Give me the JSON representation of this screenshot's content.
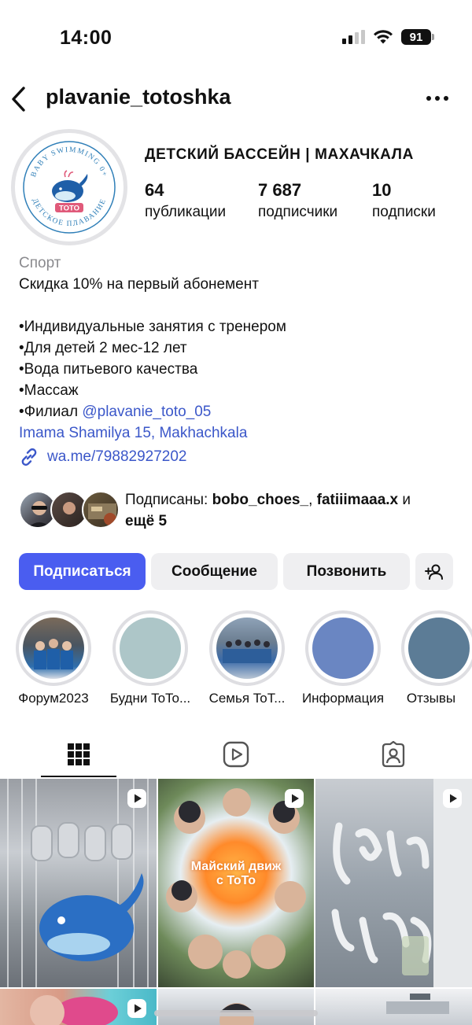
{
  "status_bar": {
    "time": "14:00",
    "battery": "91"
  },
  "header": {
    "username": "plavanie_totoshka"
  },
  "avatar": {
    "ring_text_top": "BABY SWIMMING 0+",
    "ring_text_bottom": "ДЕТСКОЕ ПЛАВАНИЕ",
    "brand": "TOTO"
  },
  "profile": {
    "display_name": "ДЕТСКИЙ БАССЕЙН | МАХАЧКАЛА",
    "stats": [
      {
        "value": "64",
        "label": "публикации"
      },
      {
        "value": "7 687",
        "label": "подписчики"
      },
      {
        "value": "10",
        "label": "подписки"
      }
    ]
  },
  "bio": {
    "category": "Спорт",
    "line1": "Скидка 10% на первый абонемент",
    "bullets": [
      "•Индивидуальные занятия с тренером",
      "•Для детей 2 мес-12 лет",
      "•Вода питьевого качества",
      "•Массаж"
    ],
    "branch_prefix": "•Филиал ",
    "branch_mention": "@plavanie_toto_05",
    "location": "Imama Shamilya 15, Makhachkala",
    "link": "wa.me/79882927202"
  },
  "followed_by": {
    "prefix": "Подписаны: ",
    "user1": "bobo_choes_",
    "sep": ", ",
    "user2": "fatiiimaaa.x",
    "and": " и",
    "more": "ещё 5"
  },
  "actions": {
    "follow": "Подписаться",
    "message": "Сообщение",
    "call": "Позвонить"
  },
  "highlights": [
    {
      "label": "Форум2023"
    },
    {
      "label": "Будни ToTo..."
    },
    {
      "label": "Семья ToT..."
    },
    {
      "label": "Информация"
    },
    {
      "label": "Отзывы"
    }
  ],
  "posts": {
    "overlay_text_line1": "Майский движ",
    "overlay_text_line2": "с ToTo"
  },
  "colors": {
    "accent": "#4a5df0",
    "link": "#3b57c9",
    "button_bg": "#efeff1",
    "muted": "#8a8a8e"
  }
}
